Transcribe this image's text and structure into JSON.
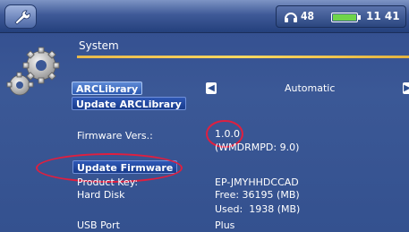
{
  "statusbar": {
    "volume": "48",
    "battery_level": 1.0,
    "clock": "11 41",
    "tools_icon": "wrench-icon",
    "headphones_icon": "headphones-icon",
    "battery_icon": "battery-icon"
  },
  "section": {
    "title": "System",
    "icon": "gears-icon"
  },
  "arclibrary": {
    "label": "ARCLibrary",
    "value": "Automatic",
    "update_button": "Update ARCLibrary"
  },
  "firmware": {
    "label": "Firmware Vers.:",
    "version": "1.0.0",
    "wmdrm": "(WMDRMPD: 9.0)",
    "update_button": "Update Firmware"
  },
  "product_key": {
    "label": "Product Key:",
    "value": "EP-JMYHHDCCAD"
  },
  "hard_disk": {
    "label": "Hard Disk",
    "free": "Free: 36195 (MB)",
    "used": "Used:  1938 (MB)"
  },
  "usb_port": {
    "label": "USB Port",
    "value": "Plus"
  },
  "colors": {
    "panel": "#3b5896",
    "accent_rule": "#ffd860",
    "highlight_ring": "#e01f3f"
  }
}
